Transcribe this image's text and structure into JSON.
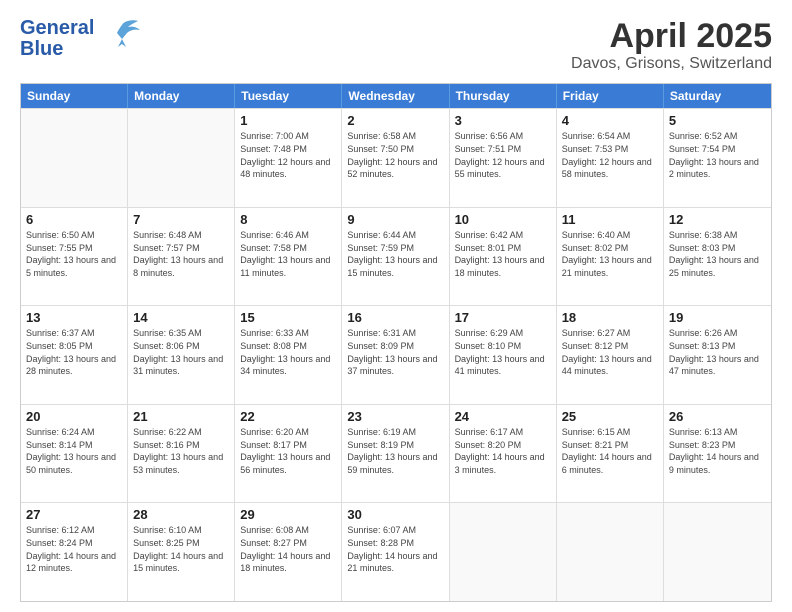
{
  "logo": {
    "line1": "General",
    "line2": "Blue"
  },
  "title": "April 2025",
  "subtitle": "Davos, Grisons, Switzerland",
  "headers": [
    "Sunday",
    "Monday",
    "Tuesday",
    "Wednesday",
    "Thursday",
    "Friday",
    "Saturday"
  ],
  "rows": [
    [
      {
        "day": "",
        "empty": true
      },
      {
        "day": "",
        "empty": true
      },
      {
        "day": "1",
        "sunrise": "Sunrise: 7:00 AM",
        "sunset": "Sunset: 7:48 PM",
        "daylight": "Daylight: 12 hours and 48 minutes."
      },
      {
        "day": "2",
        "sunrise": "Sunrise: 6:58 AM",
        "sunset": "Sunset: 7:50 PM",
        "daylight": "Daylight: 12 hours and 52 minutes."
      },
      {
        "day": "3",
        "sunrise": "Sunrise: 6:56 AM",
        "sunset": "Sunset: 7:51 PM",
        "daylight": "Daylight: 12 hours and 55 minutes."
      },
      {
        "day": "4",
        "sunrise": "Sunrise: 6:54 AM",
        "sunset": "Sunset: 7:53 PM",
        "daylight": "Daylight: 12 hours and 58 minutes."
      },
      {
        "day": "5",
        "sunrise": "Sunrise: 6:52 AM",
        "sunset": "Sunset: 7:54 PM",
        "daylight": "Daylight: 13 hours and 2 minutes."
      }
    ],
    [
      {
        "day": "6",
        "sunrise": "Sunrise: 6:50 AM",
        "sunset": "Sunset: 7:55 PM",
        "daylight": "Daylight: 13 hours and 5 minutes."
      },
      {
        "day": "7",
        "sunrise": "Sunrise: 6:48 AM",
        "sunset": "Sunset: 7:57 PM",
        "daylight": "Daylight: 13 hours and 8 minutes."
      },
      {
        "day": "8",
        "sunrise": "Sunrise: 6:46 AM",
        "sunset": "Sunset: 7:58 PM",
        "daylight": "Daylight: 13 hours and 11 minutes."
      },
      {
        "day": "9",
        "sunrise": "Sunrise: 6:44 AM",
        "sunset": "Sunset: 7:59 PM",
        "daylight": "Daylight: 13 hours and 15 minutes."
      },
      {
        "day": "10",
        "sunrise": "Sunrise: 6:42 AM",
        "sunset": "Sunset: 8:01 PM",
        "daylight": "Daylight: 13 hours and 18 minutes."
      },
      {
        "day": "11",
        "sunrise": "Sunrise: 6:40 AM",
        "sunset": "Sunset: 8:02 PM",
        "daylight": "Daylight: 13 hours and 21 minutes."
      },
      {
        "day": "12",
        "sunrise": "Sunrise: 6:38 AM",
        "sunset": "Sunset: 8:03 PM",
        "daylight": "Daylight: 13 hours and 25 minutes."
      }
    ],
    [
      {
        "day": "13",
        "sunrise": "Sunrise: 6:37 AM",
        "sunset": "Sunset: 8:05 PM",
        "daylight": "Daylight: 13 hours and 28 minutes."
      },
      {
        "day": "14",
        "sunrise": "Sunrise: 6:35 AM",
        "sunset": "Sunset: 8:06 PM",
        "daylight": "Daylight: 13 hours and 31 minutes."
      },
      {
        "day": "15",
        "sunrise": "Sunrise: 6:33 AM",
        "sunset": "Sunset: 8:08 PM",
        "daylight": "Daylight: 13 hours and 34 minutes."
      },
      {
        "day": "16",
        "sunrise": "Sunrise: 6:31 AM",
        "sunset": "Sunset: 8:09 PM",
        "daylight": "Daylight: 13 hours and 37 minutes."
      },
      {
        "day": "17",
        "sunrise": "Sunrise: 6:29 AM",
        "sunset": "Sunset: 8:10 PM",
        "daylight": "Daylight: 13 hours and 41 minutes."
      },
      {
        "day": "18",
        "sunrise": "Sunrise: 6:27 AM",
        "sunset": "Sunset: 8:12 PM",
        "daylight": "Daylight: 13 hours and 44 minutes."
      },
      {
        "day": "19",
        "sunrise": "Sunrise: 6:26 AM",
        "sunset": "Sunset: 8:13 PM",
        "daylight": "Daylight: 13 hours and 47 minutes."
      }
    ],
    [
      {
        "day": "20",
        "sunrise": "Sunrise: 6:24 AM",
        "sunset": "Sunset: 8:14 PM",
        "daylight": "Daylight: 13 hours and 50 minutes."
      },
      {
        "day": "21",
        "sunrise": "Sunrise: 6:22 AM",
        "sunset": "Sunset: 8:16 PM",
        "daylight": "Daylight: 13 hours and 53 minutes."
      },
      {
        "day": "22",
        "sunrise": "Sunrise: 6:20 AM",
        "sunset": "Sunset: 8:17 PM",
        "daylight": "Daylight: 13 hours and 56 minutes."
      },
      {
        "day": "23",
        "sunrise": "Sunrise: 6:19 AM",
        "sunset": "Sunset: 8:19 PM",
        "daylight": "Daylight: 13 hours and 59 minutes."
      },
      {
        "day": "24",
        "sunrise": "Sunrise: 6:17 AM",
        "sunset": "Sunset: 8:20 PM",
        "daylight": "Daylight: 14 hours and 3 minutes."
      },
      {
        "day": "25",
        "sunrise": "Sunrise: 6:15 AM",
        "sunset": "Sunset: 8:21 PM",
        "daylight": "Daylight: 14 hours and 6 minutes."
      },
      {
        "day": "26",
        "sunrise": "Sunrise: 6:13 AM",
        "sunset": "Sunset: 8:23 PM",
        "daylight": "Daylight: 14 hours and 9 minutes."
      }
    ],
    [
      {
        "day": "27",
        "sunrise": "Sunrise: 6:12 AM",
        "sunset": "Sunset: 8:24 PM",
        "daylight": "Daylight: 14 hours and 12 minutes."
      },
      {
        "day": "28",
        "sunrise": "Sunrise: 6:10 AM",
        "sunset": "Sunset: 8:25 PM",
        "daylight": "Daylight: 14 hours and 15 minutes."
      },
      {
        "day": "29",
        "sunrise": "Sunrise: 6:08 AM",
        "sunset": "Sunset: 8:27 PM",
        "daylight": "Daylight: 14 hours and 18 minutes."
      },
      {
        "day": "30",
        "sunrise": "Sunrise: 6:07 AM",
        "sunset": "Sunset: 8:28 PM",
        "daylight": "Daylight: 14 hours and 21 minutes."
      },
      {
        "day": "",
        "empty": true
      },
      {
        "day": "",
        "empty": true
      },
      {
        "day": "",
        "empty": true
      }
    ]
  ]
}
